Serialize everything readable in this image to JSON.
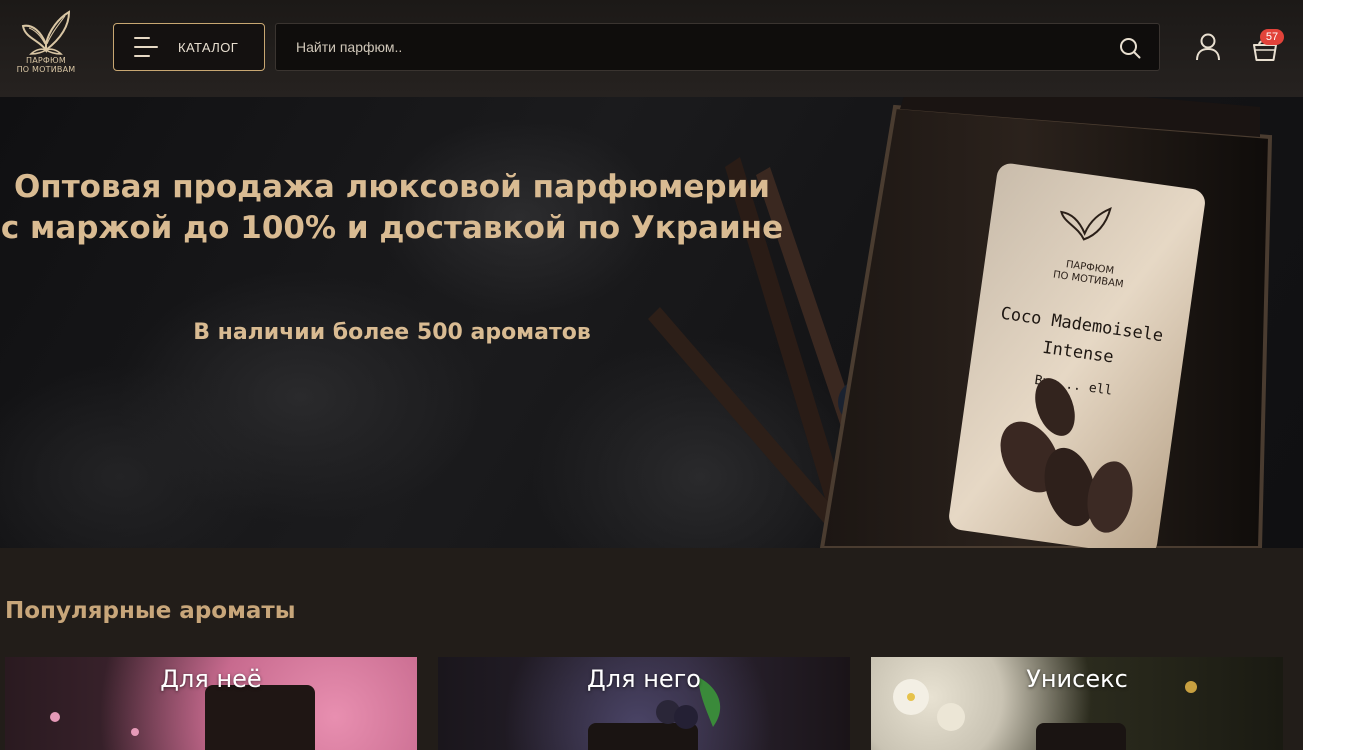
{
  "header": {
    "logo": {
      "line1": "ПАРФЮМ",
      "line2": "ПО МОТИВАМ",
      "icon": "butterfly-logo-icon"
    },
    "catalog_label": "КАТАЛОГ",
    "search": {
      "placeholder": "Найти парфюм..",
      "value": ""
    },
    "cart_count": "57"
  },
  "hero": {
    "title": "Оптовая продажа люксовой парфюмерии с маржой до 100% и доставкой по Украине",
    "subtitle": "В наличии более 500 ароматов",
    "bottle_label": {
      "brand_line1": "ПАРФЮМ",
      "brand_line2": "ПО МОТИВАМ",
      "name_line1": "Coco Mademoisele",
      "name_line2": "Intense",
      "by": "By ... ell"
    }
  },
  "popular": {
    "title": "Популярные ароматы",
    "cards": [
      {
        "label": "Для неё"
      },
      {
        "label": "Для него"
      },
      {
        "label": "Унисекс"
      }
    ]
  },
  "colors": {
    "accent_gold": "#d9bb92",
    "background": "#221d19",
    "badge_red": "#e2433a"
  }
}
